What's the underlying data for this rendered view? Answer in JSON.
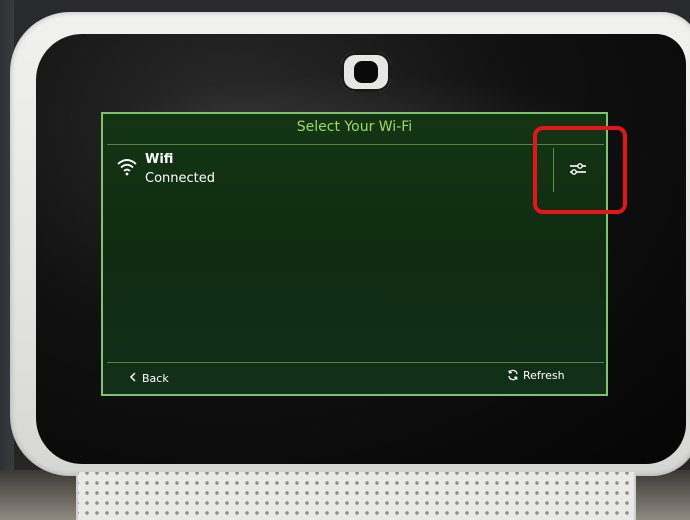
{
  "screen": {
    "title": "Select Your Wi-Fi",
    "networks": [
      {
        "name": "Wifi",
        "status": "Connected",
        "icon": "wifi-icon"
      }
    ],
    "settings_icon": "sliders-icon",
    "back_label": "Back",
    "back_icon": "chevron-left-icon",
    "refresh_label": "Refresh",
    "refresh_icon": "refresh-icon"
  },
  "colors": {
    "screen_bg": "#123214",
    "accent_green": "#7ec46e",
    "title_green": "#9bd96a",
    "highlight_red": "#e4161c",
    "bezel": "#ececea"
  }
}
